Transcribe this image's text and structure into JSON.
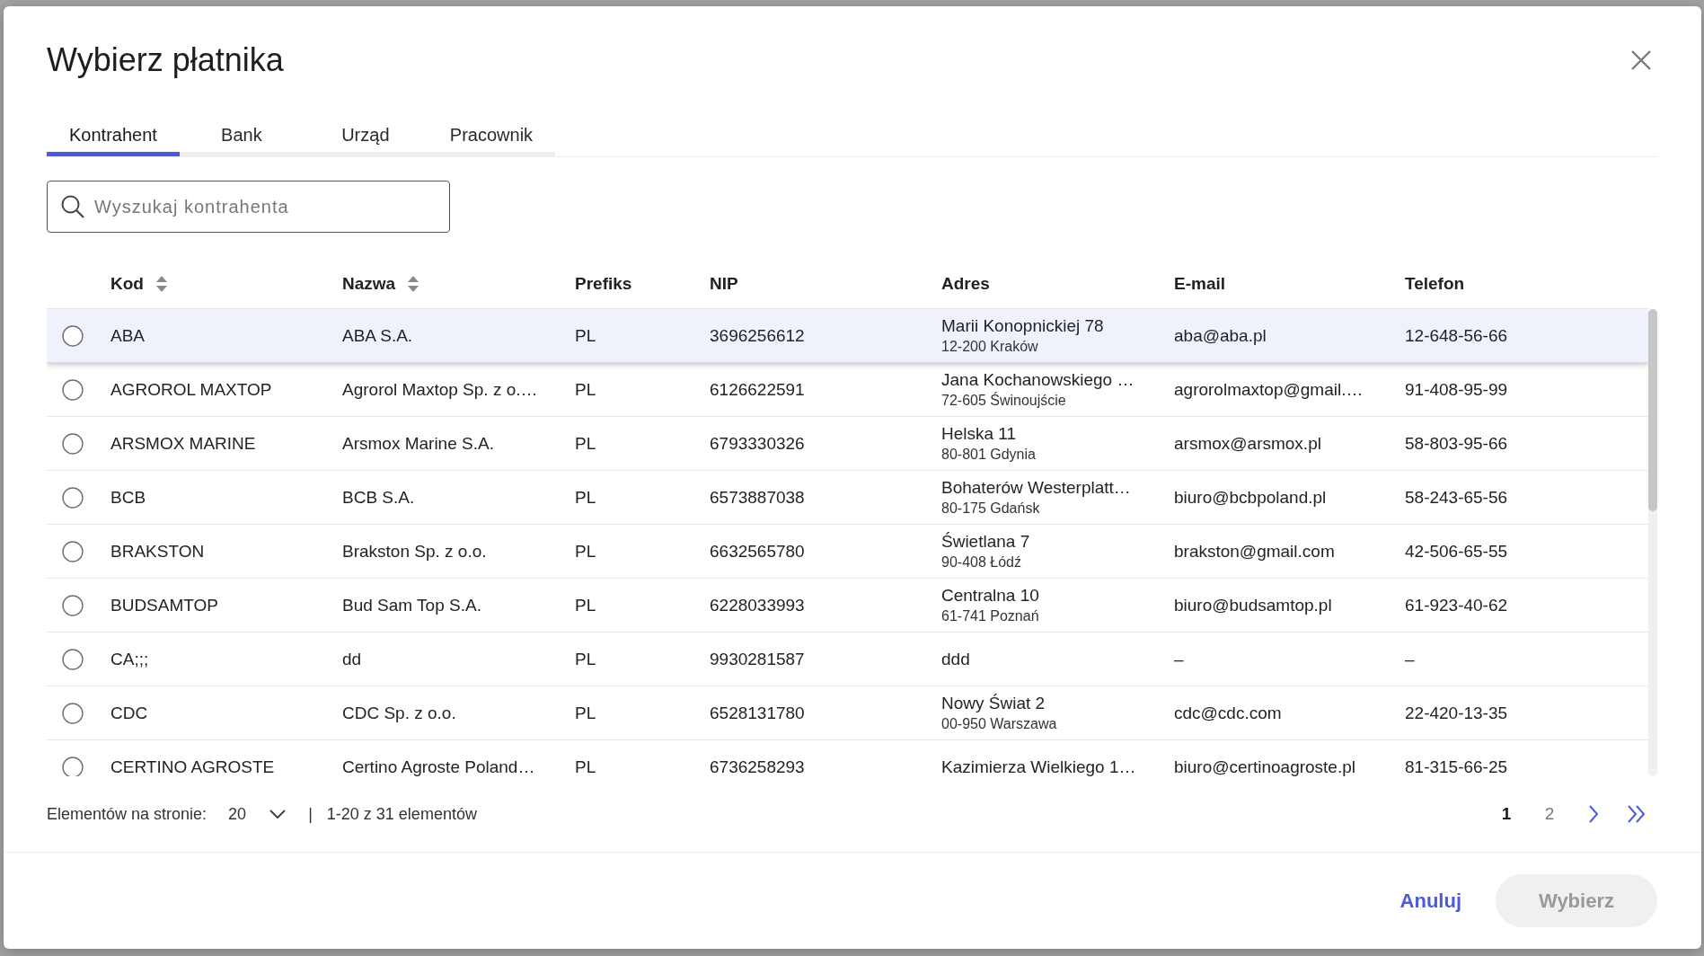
{
  "dialog": {
    "title": "Wybierz płatnika"
  },
  "tabs": [
    {
      "label": "Kontrahent",
      "selected": true
    },
    {
      "label": "Bank",
      "selected": false
    },
    {
      "label": "Urząd",
      "selected": false
    },
    {
      "label": "Pracownik",
      "selected": false
    }
  ],
  "search": {
    "placeholder": "Wyszukaj kontrahenta"
  },
  "table": {
    "columns": [
      {
        "label": "Kod",
        "sortable": true
      },
      {
        "label": "Nazwa",
        "sortable": true
      },
      {
        "label": "Prefiks",
        "sortable": false
      },
      {
        "label": "NIP",
        "sortable": false
      },
      {
        "label": "Adres",
        "sortable": false
      },
      {
        "label": "E-mail",
        "sortable": false
      },
      {
        "label": "Telefon",
        "sortable": false
      }
    ],
    "rows": [
      {
        "selected": false,
        "highlighted": true,
        "code": "ABA",
        "name": "ABA S.A.",
        "prefix": "PL",
        "nip": "3696256612",
        "address": [
          "Marii Konopnickiej 78",
          "12-200 Kraków"
        ],
        "email": "aba@aba.pl",
        "phone": "12-648-56-66"
      },
      {
        "selected": false,
        "highlighted": false,
        "code": "AGROROL MAXTOP",
        "name": "Agrorol Maxtop Sp. z o.…",
        "prefix": "PL",
        "nip": "6126622591",
        "address": [
          "Jana Kochanowskiego …",
          "72-605 Świnoujście"
        ],
        "email": "agrorolmaxtop@gmail.…",
        "phone": "91-408-95-99"
      },
      {
        "selected": false,
        "highlighted": false,
        "code": "ARSMOX MARINE",
        "name": "Arsmox Marine S.A.",
        "prefix": "PL",
        "nip": "6793330326",
        "address": [
          "Helska 11",
          "80-801 Gdynia"
        ],
        "email": "arsmox@arsmox.pl",
        "phone": "58-803-95-66"
      },
      {
        "selected": false,
        "highlighted": false,
        "code": "BCB",
        "name": "BCB S.A.",
        "prefix": "PL",
        "nip": "6573887038",
        "address": [
          "Bohaterów Westerplatt…",
          "80-175 Gdańsk"
        ],
        "email": "biuro@bcbpoland.pl",
        "phone": "58-243-65-56"
      },
      {
        "selected": false,
        "highlighted": false,
        "code": "BRAKSTON",
        "name": "Brakston Sp. z o.o.",
        "prefix": "PL",
        "nip": "6632565780",
        "address": [
          "Świetlana 7",
          "90-408 Łódź"
        ],
        "email": "brakston@gmail.com",
        "phone": "42-506-65-55"
      },
      {
        "selected": false,
        "highlighted": false,
        "code": "BUDSAMTOP",
        "name": "Bud Sam Top S.A.",
        "prefix": "PL",
        "nip": "6228033993",
        "address": [
          "Centralna 10",
          "61-741 Poznań"
        ],
        "email": "biuro@budsamtop.pl",
        "phone": "61-923-40-62"
      },
      {
        "selected": false,
        "highlighted": false,
        "code": "CA;;;",
        "name": "dd",
        "prefix": "PL",
        "nip": "9930281587",
        "address": [
          "ddd"
        ],
        "email": "–",
        "phone": "–"
      },
      {
        "selected": false,
        "highlighted": false,
        "code": "CDC",
        "name": "CDC Sp. z o.o.",
        "prefix": "PL",
        "nip": "6528131780",
        "address": [
          "Nowy Świat 2",
          "00-950 Warszawa"
        ],
        "email": "cdc@cdc.com",
        "phone": "22-420-13-35"
      },
      {
        "selected": false,
        "highlighted": false,
        "code": "CERTINO AGROSTE",
        "name": "Certino Agroste Poland…",
        "prefix": "PL",
        "nip": "6736258293",
        "address": [
          "Kazimierza Wielkiego 1…"
        ],
        "email": "biuro@certinoagroste.pl",
        "phone": "81-315-66-25"
      }
    ]
  },
  "pagination": {
    "page_size_label": "Elementów na stronie:",
    "page_size": "20",
    "separator": "|",
    "range": "1-20 z 31 elementów",
    "pages": [
      {
        "label": "1",
        "selected": true
      },
      {
        "label": "2",
        "selected": false
      }
    ]
  },
  "buttons": [
    {
      "label": "Anuluj",
      "kind": "text",
      "disabled": false
    },
    {
      "label": "Wybierz",
      "kind": "filled",
      "disabled": true
    }
  ]
}
